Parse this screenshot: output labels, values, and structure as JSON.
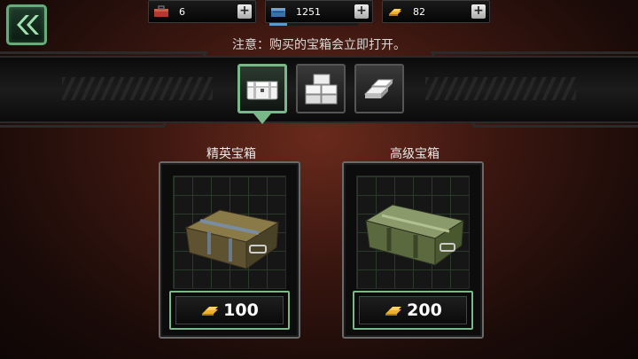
{
  "resources": [
    {
      "name": "toolbox-icon",
      "value": "6",
      "color": "#c0463a"
    },
    {
      "name": "blue-crate-icon",
      "value": "1251",
      "color": "#4a88c8",
      "progress": 0.2
    },
    {
      "name": "gold-bars-icon",
      "value": "82",
      "color": "#e8a020"
    }
  ],
  "plus_label": "+",
  "notice": "注意：购买的宝箱会立即打开。",
  "tabs": [
    {
      "icon": "chest-tab-icon",
      "active": true
    },
    {
      "icon": "crates-stack-tab-icon",
      "active": false
    },
    {
      "icon": "silver-bars-tab-icon",
      "active": false
    }
  ],
  "chests": [
    {
      "title": "精英宝箱",
      "price": "100",
      "color": "#5a4a2a"
    },
    {
      "title": "高级宝箱",
      "price": "200",
      "color": "#4a5a3a"
    }
  ],
  "colors": {
    "accent_green": "#7ab88a",
    "gold": "#e8a020"
  }
}
